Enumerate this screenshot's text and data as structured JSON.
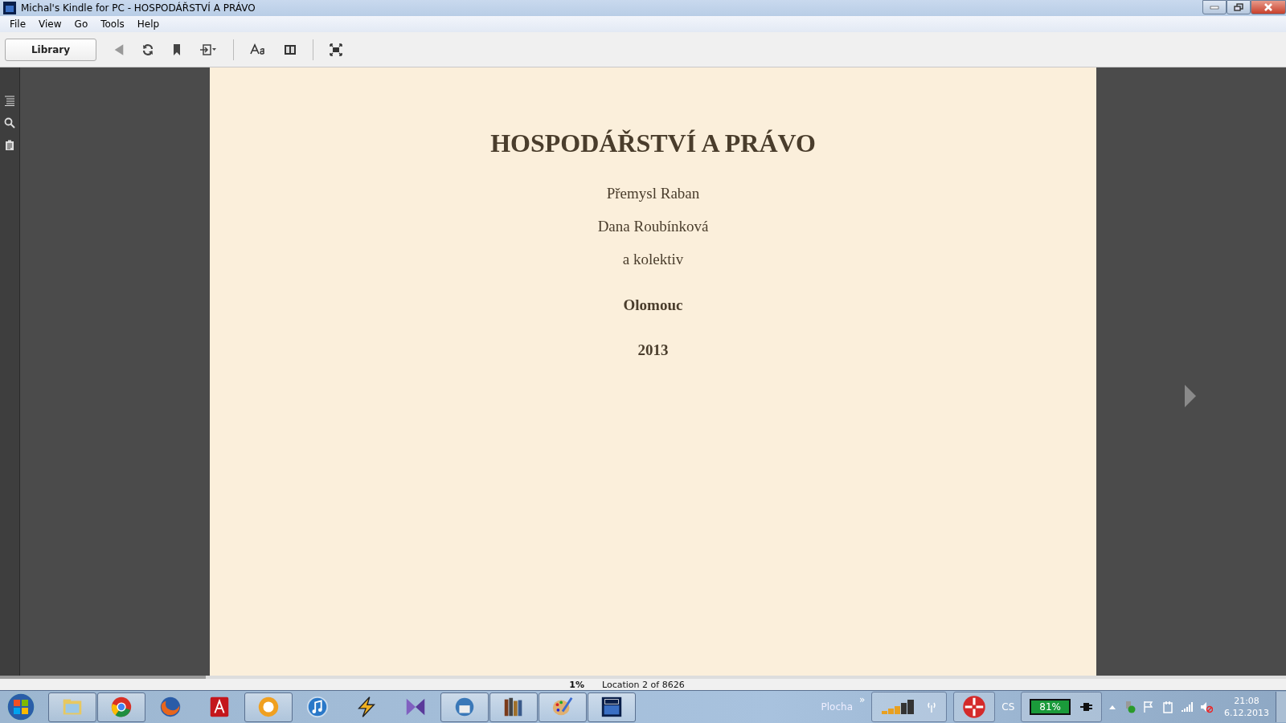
{
  "window": {
    "title": "Michal's Kindle for PC - HOSPODÁŘSTVÍ A PRÁVO"
  },
  "menu": [
    "File",
    "View",
    "Go",
    "Tools",
    "Help"
  ],
  "toolbar": {
    "library_button": "Library",
    "back_disabled": true
  },
  "book_page": {
    "title": "HOSPODÁŘSTVÍ A PRÁVO",
    "lines": [
      {
        "text": "Přemysl Raban",
        "bold": false
      },
      {
        "text": "Dana Roubínková",
        "bold": false
      },
      {
        "text": "a kolektiv",
        "bold": false
      },
      {
        "text": "Olomouc",
        "bold": true
      },
      {
        "text": "2013",
        "bold": true
      }
    ]
  },
  "reading_progress": {
    "level": 0.16
  },
  "status_bar": {
    "percent": "1%",
    "location": "Location 2 of 8626"
  },
  "taskbar": {
    "apps": [
      {
        "kind": "folder",
        "running": true
      },
      {
        "kind": "chrome",
        "running": true
      },
      {
        "kind": "firefox",
        "running": false
      },
      {
        "kind": "acrobat",
        "running": false
      },
      {
        "kind": "orange",
        "running": true
      },
      {
        "kind": "music",
        "running": false
      },
      {
        "kind": "bolt",
        "running": false
      },
      {
        "kind": "vs",
        "running": false
      },
      {
        "kind": "mail",
        "running": true
      },
      {
        "kind": "books",
        "running": true
      },
      {
        "kind": "palette",
        "running": true
      },
      {
        "kind": "kindle",
        "running": true
      }
    ],
    "desktop_label": "Plocha",
    "chevron": "»",
    "language": "CS",
    "battery": "81%",
    "time": "21:08",
    "date": "6.12.2013"
  }
}
